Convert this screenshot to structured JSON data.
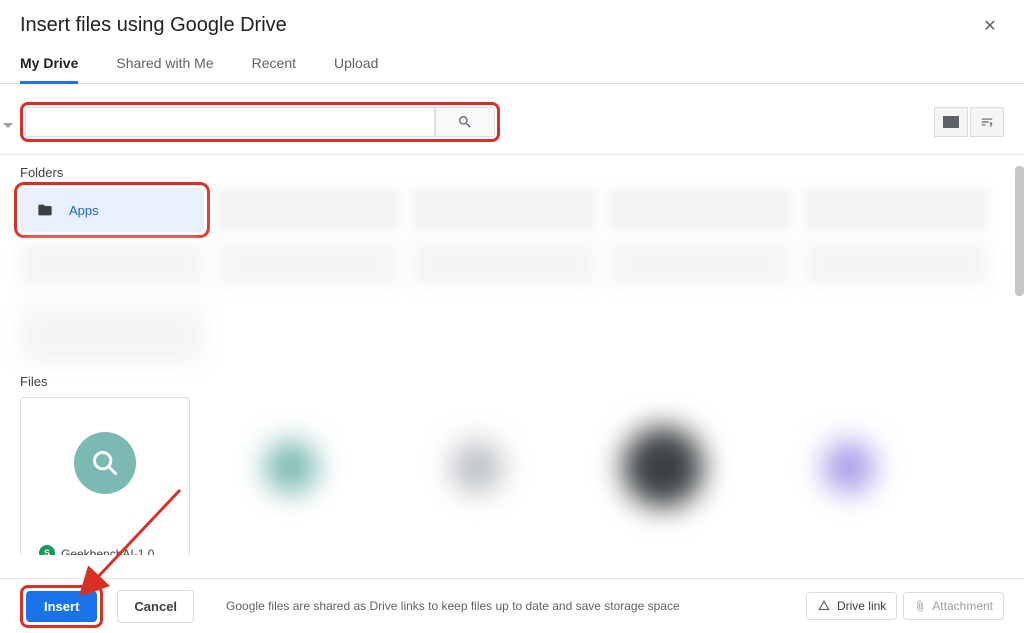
{
  "dialog": {
    "title": "Insert files using Google Drive"
  },
  "tabs": {
    "mydrive": "My Drive",
    "shared": "Shared with Me",
    "recent": "Recent",
    "upload": "Upload"
  },
  "search": {
    "placeholder": ""
  },
  "sections": {
    "folders": "Folders",
    "files": "Files"
  },
  "folders": {
    "apps": "Apps"
  },
  "files": {
    "first": "GeekbenchAI-1.0"
  },
  "footer": {
    "insert": "Insert",
    "cancel": "Cancel",
    "note": "Google files are shared as Drive links to keep files up to date and save storage space",
    "drivelink": "Drive link",
    "attachment": "Attachment"
  }
}
